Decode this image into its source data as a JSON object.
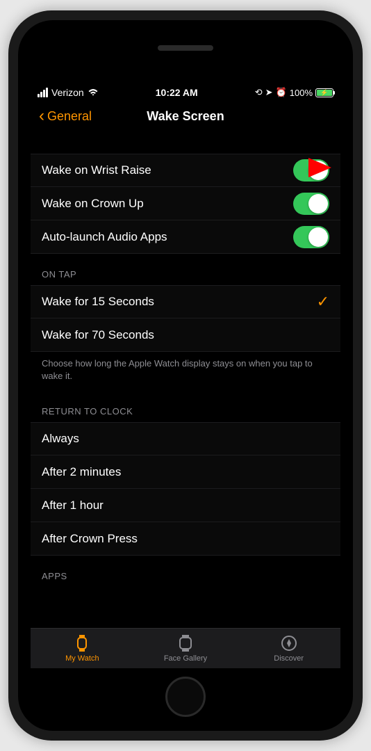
{
  "status": {
    "carrier": "Verizon",
    "time": "10:22 AM",
    "battery_pct": "100%"
  },
  "nav": {
    "back_label": "General",
    "title": "Wake Screen"
  },
  "toggles": [
    {
      "label": "Wake on Wrist Raise",
      "on": true
    },
    {
      "label": "Wake on Crown Up",
      "on": true
    },
    {
      "label": "Auto-launch Audio Apps",
      "on": true
    }
  ],
  "on_tap": {
    "header": "ON TAP",
    "options": [
      {
        "label": "Wake for 15 Seconds",
        "selected": true
      },
      {
        "label": "Wake for 70 Seconds",
        "selected": false
      }
    ],
    "footer": "Choose how long the Apple Watch display stays on when you tap to wake it."
  },
  "return_to_clock": {
    "header": "RETURN TO CLOCK",
    "options": [
      {
        "label": "Always"
      },
      {
        "label": "After 2 minutes"
      },
      {
        "label": "After 1 hour"
      },
      {
        "label": "After Crown Press"
      }
    ]
  },
  "apps_header": "APPS",
  "tabs": {
    "my_watch": "My Watch",
    "face_gallery": "Face Gallery",
    "discover": "Discover"
  }
}
